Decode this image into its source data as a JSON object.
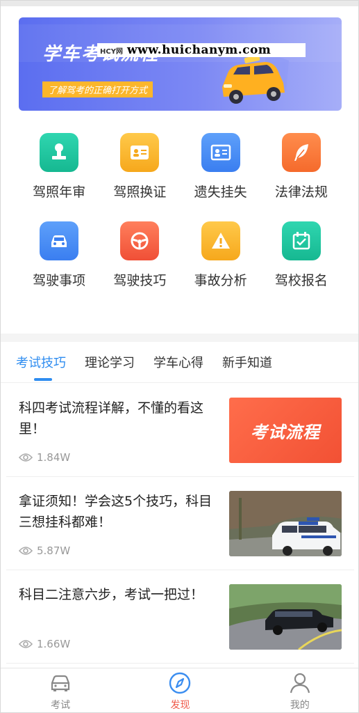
{
  "banner": {
    "title": "学车考试流程",
    "subtitle": "了解驾考的正确打开方式",
    "watermark_logo": "HCY网",
    "watermark_url": "www.huichanym.com"
  },
  "grid": [
    {
      "label": "驾照年审",
      "icon": "stamp-icon",
      "color": "#21c6a0"
    },
    {
      "label": "驾照换证",
      "icon": "id-card-icon",
      "color": "#fbb62b"
    },
    {
      "label": "遗失挂失",
      "icon": "profile-card-icon",
      "color": "#4b8ff4"
    },
    {
      "label": "法律法规",
      "icon": "feather-icon",
      "color": "#ff7a3c"
    },
    {
      "label": "驾驶事项",
      "icon": "car-icon",
      "color": "#4b8ff4"
    },
    {
      "label": "驾驶技巧",
      "icon": "steering-wheel-icon",
      "color": "#ff6a4a"
    },
    {
      "label": "事故分析",
      "icon": "warning-icon",
      "color": "#fbb62b"
    },
    {
      "label": "驾校报名",
      "icon": "calendar-check-icon",
      "color": "#21c6a0"
    }
  ],
  "tabs": [
    {
      "label": "考试技巧",
      "active": true
    },
    {
      "label": "理论学习",
      "active": false
    },
    {
      "label": "学车心得",
      "active": false
    },
    {
      "label": "新手知道",
      "active": false
    }
  ],
  "articles": [
    {
      "title": "科四考试流程详解，不懂的看这里！",
      "views": "1.84W",
      "thumb_text": "考试流程"
    },
    {
      "title": "拿证须知！学会这5个技巧，科目三想挂科都难！",
      "views": "5.87W"
    },
    {
      "title": "科目二注意六步，考试一把过！",
      "views": "1.66W"
    }
  ],
  "nav": [
    {
      "label": "考试",
      "icon": "car-front-icon",
      "active": false
    },
    {
      "label": "发现",
      "icon": "compass-icon",
      "active": true
    },
    {
      "label": "我的",
      "icon": "user-icon",
      "active": false
    }
  ],
  "colors": {
    "accent": "#2f8df0",
    "nav_active": "#ef5a4a",
    "banner": "#5b6ef0"
  }
}
